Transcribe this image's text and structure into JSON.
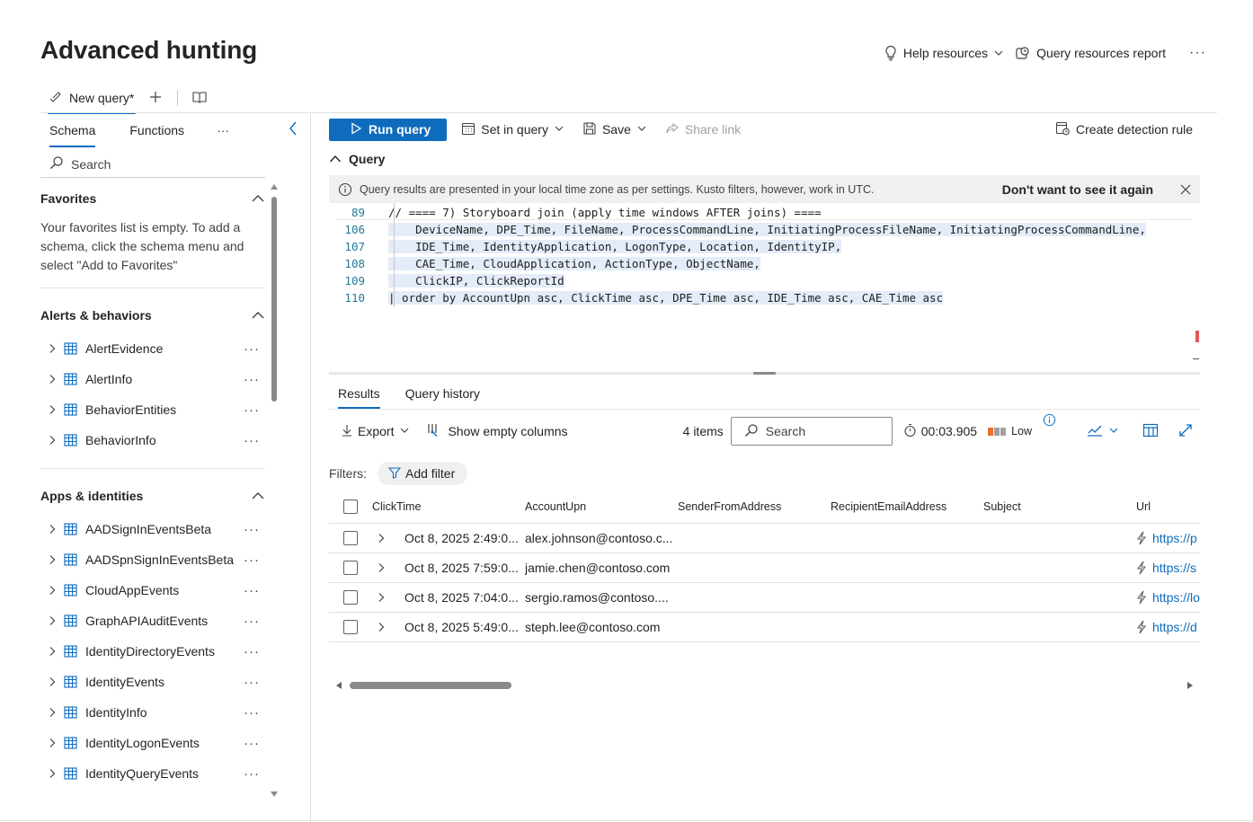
{
  "page": {
    "title": "Advanced hunting"
  },
  "top_actions": {
    "help": "Help resources",
    "report": "Query resources report",
    "more": "···"
  },
  "query_tab": {
    "label": "New query*"
  },
  "side": {
    "tabs": {
      "schema": "Schema",
      "functions": "Functions",
      "more": "···"
    },
    "search_label": "Search",
    "favorites": {
      "title": "Favorites",
      "text": "Your favorites list is empty. To add a schema, click the schema menu and select \"Add to Favorites\""
    },
    "alerts": {
      "title": "Alerts & behaviors",
      "items": [
        "AlertEvidence",
        "AlertInfo",
        "BehaviorEntities",
        "BehaviorInfo"
      ]
    },
    "apps": {
      "title": "Apps & identities",
      "items": [
        "AADSignInEventsBeta",
        "AADSpnSignInEventsBeta",
        "CloudAppEvents",
        "GraphAPIAuditEvents",
        "IdentityDirectoryEvents",
        "IdentityEvents",
        "IdentityInfo",
        "IdentityLogonEvents",
        "IdentityQueryEvents"
      ]
    },
    "item_more": "···"
  },
  "toolbar": {
    "run": "Run query",
    "set_in_query": "Set in query",
    "save": "Save",
    "share": "Share link",
    "create_rule": "Create detection rule"
  },
  "query": {
    "section_title": "Query",
    "info_text": "Query results are presented in your local time zone as per settings. Kusto filters, however, work in UTC.",
    "dismiss": "Don't want to see it again",
    "lines": [
      {
        "num": "89",
        "text": "// ==== 7) Storyboard join (apply time windows AFTER joins) ===="
      },
      {
        "num": "106",
        "text": "    DeviceName, DPE_Time, FileName, ProcessCommandLine, InitiatingProcessFileName, InitiatingProcessCommandLine,"
      },
      {
        "num": "107",
        "text": "    IDE_Time, IdentityApplication, LogonType, Location, IdentityIP,"
      },
      {
        "num": "108",
        "text": "    CAE_Time, CloudApplication, ActionType, ObjectName,"
      },
      {
        "num": "109",
        "text": "    ClickIP, ClickReportId"
      },
      {
        "num": "110",
        "text": "| order by AccountUpn asc, ClickTime asc, DPE_Time asc, IDE_Time asc, CAE_Time asc"
      }
    ]
  },
  "results": {
    "tabs": {
      "results": "Results",
      "history": "Query history"
    },
    "export": "Export",
    "show_empty": "Show empty columns",
    "count": "4 items",
    "search_placeholder": "Search",
    "duration": "00:03.905",
    "load": "Low",
    "filters_label": "Filters:",
    "add_filter": "Add filter",
    "columns": [
      "ClickTime",
      "AccountUpn",
      "SenderFromAddress",
      "RecipientEmailAddress",
      "Subject",
      "Url"
    ],
    "rows": [
      {
        "click_time": "Oct 8, 2025 2:49:0...",
        "account": "alex.johnson@contoso.c...",
        "sender": "",
        "recipient": "",
        "subject": "",
        "url": "https://p"
      },
      {
        "click_time": "Oct 8, 2025 7:59:0...",
        "account": "jamie.chen@contoso.com",
        "sender": "",
        "recipient": "",
        "subject": "",
        "url": "https://s"
      },
      {
        "click_time": "Oct 8, 2025 7:04:0...",
        "account": "sergio.ramos@contoso....",
        "sender": "",
        "recipient": "",
        "subject": "",
        "url": "https://lo"
      },
      {
        "click_time": "Oct 8, 2025 5:49:0...",
        "account": "steph.lee@contoso.com",
        "sender": "",
        "recipient": "",
        "subject": "",
        "url": "https://d"
      }
    ]
  },
  "colors": {
    "accent": "#0f6cbd",
    "load_high": "#e8702a",
    "load_low": "#a0a0a0"
  }
}
